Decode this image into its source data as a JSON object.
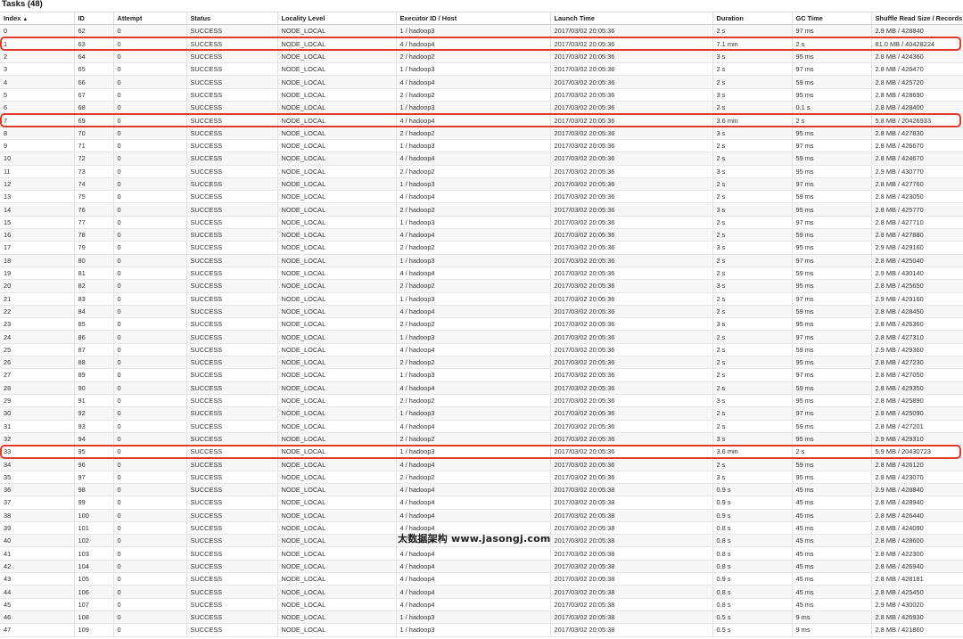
{
  "title": "Tasks (48)",
  "columns": [
    "Index",
    "ID",
    "Attempt",
    "Status",
    "Locality Level",
    "Executor ID / Host",
    "Launch Time",
    "Duration",
    "GC Time",
    "Shuffle Read Size / Records"
  ],
  "sort_indicator": "▲",
  "highlight_color": "#e5392b",
  "highlighted_rows": [
    1,
    7,
    33
  ],
  "rows": [
    [
      "0",
      "62",
      "0",
      "SUCCESS",
      "NODE_LOCAL",
      "1 / hadoop3",
      "2017/03/02 20:05:36",
      "2 s",
      "97 ms",
      "2.9 MB / 428840"
    ],
    [
      "1",
      "63",
      "0",
      "SUCCESS",
      "NODE_LOCAL",
      "4 / hadoop4",
      "2017/03/02 20:05:36",
      "7.1 min",
      "2 s",
      "81.0 MB / 40428224"
    ],
    [
      "2",
      "64",
      "0",
      "SUCCESS",
      "NODE_LOCAL",
      "2 / hadoop2",
      "2017/03/02 20:05:36",
      "3 s",
      "95 ms",
      "2.8 MB / 424360"
    ],
    [
      "3",
      "65",
      "0",
      "SUCCESS",
      "NODE_LOCAL",
      "1 / hadoop3",
      "2017/03/02 20:05:36",
      "2 s",
      "97 ms",
      "2.8 MB / 426470"
    ],
    [
      "4",
      "66",
      "0",
      "SUCCESS",
      "NODE_LOCAL",
      "4 / hadoop4",
      "2017/03/02 20:05:36",
      "2 s",
      "59 ms",
      "2.8 MB / 425720"
    ],
    [
      "5",
      "67",
      "0",
      "SUCCESS",
      "NODE_LOCAL",
      "2 / hadoop2",
      "2017/03/02 20:05:36",
      "3 s",
      "95 ms",
      "2.8 MB / 428690"
    ],
    [
      "6",
      "68",
      "0",
      "SUCCESS",
      "NODE_LOCAL",
      "1 / hadoop3",
      "2017/03/02 20:05:36",
      "2 s",
      "0.1 s",
      "2.8 MB / 428400"
    ],
    [
      "7",
      "69",
      "0",
      "SUCCESS",
      "NODE_LOCAL",
      "4 / hadoop4",
      "2017/03/02 20:05:36",
      "3.6 min",
      "2 s",
      "5.8 MB / 20426933"
    ],
    [
      "8",
      "70",
      "0",
      "SUCCESS",
      "NODE_LOCAL",
      "2 / hadoop2",
      "2017/03/02 20:05:36",
      "3 s",
      "95 ms",
      "2.8 MB / 427830"
    ],
    [
      "9",
      "71",
      "0",
      "SUCCESS",
      "NODE_LOCAL",
      "1 / hadoop3",
      "2017/03/02 20:05:36",
      "2 s",
      "97 ms",
      "2.8 MB / 426670"
    ],
    [
      "10",
      "72",
      "0",
      "SUCCESS",
      "NODE_LOCAL",
      "4 / hadoop4",
      "2017/03/02 20:05:36",
      "2 s",
      "59 ms",
      "2.8 MB / 424670"
    ],
    [
      "11",
      "73",
      "0",
      "SUCCESS",
      "NODE_LOCAL",
      "2 / hadoop2",
      "2017/03/02 20:05:36",
      "3 s",
      "95 ms",
      "2.9 MB / 430770"
    ],
    [
      "12",
      "74",
      "0",
      "SUCCESS",
      "NODE_LOCAL",
      "1 / hadoop3",
      "2017/03/02 20:05:36",
      "2 s",
      "97 ms",
      "2.8 MB / 427760"
    ],
    [
      "13",
      "75",
      "0",
      "SUCCESS",
      "NODE_LOCAL",
      "4 / hadoop4",
      "2017/03/02 20:05:36",
      "2 s",
      "59 ms",
      "2.8 MB / 423050"
    ],
    [
      "14",
      "76",
      "0",
      "SUCCESS",
      "NODE_LOCAL",
      "2 / hadoop2",
      "2017/03/02 20:05:36",
      "3 s",
      "95 ms",
      "2.8 MB / 425770"
    ],
    [
      "15",
      "77",
      "0",
      "SUCCESS",
      "NODE_LOCAL",
      "1 / hadoop3",
      "2017/03/02 20:05:36",
      "2 s",
      "97 ms",
      "2.8 MB / 427710"
    ],
    [
      "16",
      "78",
      "0",
      "SUCCESS",
      "NODE_LOCAL",
      "4 / hadoop4",
      "2017/03/02 20:05:36",
      "2 s",
      "59 ms",
      "2.8 MB / 427880"
    ],
    [
      "17",
      "79",
      "0",
      "SUCCESS",
      "NODE_LOCAL",
      "2 / hadoop2",
      "2017/03/02 20:05:36",
      "3 s",
      "95 ms",
      "2.9 MB / 429160"
    ],
    [
      "18",
      "80",
      "0",
      "SUCCESS",
      "NODE_LOCAL",
      "1 / hadoop3",
      "2017/03/02 20:05:36",
      "2 s",
      "97 ms",
      "2.8 MB / 425040"
    ],
    [
      "19",
      "81",
      "0",
      "SUCCESS",
      "NODE_LOCAL",
      "4 / hadoop4",
      "2017/03/02 20:05:36",
      "2 s",
      "59 ms",
      "2.9 MB / 430140"
    ],
    [
      "20",
      "82",
      "0",
      "SUCCESS",
      "NODE_LOCAL",
      "2 / hadoop2",
      "2017/03/02 20:05:36",
      "3 s",
      "95 ms",
      "2.8 MB / 425650"
    ],
    [
      "21",
      "83",
      "0",
      "SUCCESS",
      "NODE_LOCAL",
      "1 / hadoop3",
      "2017/03/02 20:05:36",
      "2 s",
      "97 ms",
      "2.9 MB / 429160"
    ],
    [
      "22",
      "84",
      "0",
      "SUCCESS",
      "NODE_LOCAL",
      "4 / hadoop4",
      "2017/03/02 20:05:36",
      "2 s",
      "59 ms",
      "2.8 MB / 428450"
    ],
    [
      "23",
      "85",
      "0",
      "SUCCESS",
      "NODE_LOCAL",
      "2 / hadoop2",
      "2017/03/02 20:05:36",
      "3 s",
      "95 ms",
      "2.8 MB / 426360"
    ],
    [
      "24",
      "86",
      "0",
      "SUCCESS",
      "NODE_LOCAL",
      "1 / hadoop3",
      "2017/03/02 20:05:36",
      "2 s",
      "97 ms",
      "2.8 MB / 427310"
    ],
    [
      "25",
      "87",
      "0",
      "SUCCESS",
      "NODE_LOCAL",
      "4 / hadoop4",
      "2017/03/02 20:05:36",
      "2 s",
      "59 ms",
      "2.9 MB / 429360"
    ],
    [
      "26",
      "88",
      "0",
      "SUCCESS",
      "NODE_LOCAL",
      "2 / hadoop2",
      "2017/03/02 20:05:36",
      "2 s",
      "95 ms",
      "2.8 MB / 427230"
    ],
    [
      "27",
      "89",
      "0",
      "SUCCESS",
      "NODE_LOCAL",
      "1 / hadoop3",
      "2017/03/02 20:05:36",
      "2 s",
      "97 ms",
      "2.8 MB / 427050"
    ],
    [
      "28",
      "90",
      "0",
      "SUCCESS",
      "NODE_LOCAL",
      "4 / hadoop4",
      "2017/03/02 20:05:36",
      "2 s",
      "59 ms",
      "2.8 MB / 429350"
    ],
    [
      "29",
      "91",
      "0",
      "SUCCESS",
      "NODE_LOCAL",
      "2 / hadoop2",
      "2017/03/02 20:05:36",
      "3 s",
      "95 ms",
      "2.8 MB / 425890"
    ],
    [
      "30",
      "92",
      "0",
      "SUCCESS",
      "NODE_LOCAL",
      "1 / hadoop3",
      "2017/03/02 20:05:36",
      "2 s",
      "97 ms",
      "2.8 MB / 425090"
    ],
    [
      "31",
      "93",
      "0",
      "SUCCESS",
      "NODE_LOCAL",
      "4 / hadoop4",
      "2017/03/02 20:05:36",
      "2 s",
      "59 ms",
      "2.8 MB / 427201"
    ],
    [
      "32",
      "94",
      "0",
      "SUCCESS",
      "NODE_LOCAL",
      "2 / hadoop2",
      "2017/03/02 20:05:36",
      "3 s",
      "95 ms",
      "2.9 MB / 429310"
    ],
    [
      "33",
      "95",
      "0",
      "SUCCESS",
      "NODE_LOCAL",
      "1 / hadoop3",
      "2017/03/02 20:05:36",
      "3.6 min",
      "2 s",
      "5.9 MB / 20430723"
    ],
    [
      "34",
      "96",
      "0",
      "SUCCESS",
      "NODE_LOCAL",
      "4 / hadoop4",
      "2017/03/02 20:05:36",
      "2 s",
      "59 ms",
      "2.8 MB / 426120"
    ],
    [
      "35",
      "97",
      "0",
      "SUCCESS",
      "NODE_LOCAL",
      "2 / hadoop2",
      "2017/03/02 20:05:36",
      "3 s",
      "95 ms",
      "2.8 MB / 423070"
    ],
    [
      "36",
      "98",
      "0",
      "SUCCESS",
      "NODE_LOCAL",
      "4 / hadoop4",
      "2017/03/02 20:05:38",
      "0.9 s",
      "45 ms",
      "2.9 MB / 428840"
    ],
    [
      "37",
      "99",
      "0",
      "SUCCESS",
      "NODE_LOCAL",
      "4 / hadoop4",
      "2017/03/02 20:05:38",
      "0.9 s",
      "45 ms",
      "2.8 MB / 428940"
    ],
    [
      "38",
      "100",
      "0",
      "SUCCESS",
      "NODE_LOCAL",
      "4 / hadoop4",
      "2017/03/02 20:05:38",
      "0.9 s",
      "45 ms",
      "2.8 MB / 426440"
    ],
    [
      "39",
      "101",
      "0",
      "SUCCESS",
      "NODE_LOCAL",
      "4 / hadoop4",
      "2017/03/02 20:05:38",
      "0.8 s",
      "45 ms",
      "2.8 MB / 424090"
    ],
    [
      "40",
      "102",
      "0",
      "SUCCESS",
      "NODE_LOCAL",
      "4 / hadoop4",
      "2017/03/02 20:05:38",
      "0.8 s",
      "45 ms",
      "2.8 MB / 428600"
    ],
    [
      "41",
      "103",
      "0",
      "SUCCESS",
      "NODE_LOCAL",
      "4 / hadoop4",
      "2017/03/02 20:05:38",
      "0.8 s",
      "45 ms",
      "2.8 MB / 422300"
    ],
    [
      "42",
      "104",
      "0",
      "SUCCESS",
      "NODE_LOCAL",
      "4 / hadoop4",
      "2017/03/02 20:05:38",
      "0.8 s",
      "45 ms",
      "2.8 MB / 426940"
    ],
    [
      "43",
      "105",
      "0",
      "SUCCESS",
      "NODE_LOCAL",
      "4 / hadoop4",
      "2017/03/02 20:05:38",
      "0.9 s",
      "45 ms",
      "2.8 MB / 428181"
    ],
    [
      "44",
      "106",
      "0",
      "SUCCESS",
      "NODE_LOCAL",
      "4 / hadoop4",
      "2017/03/02 20:05:38",
      "0.8 s",
      "45 ms",
      "2.8 MB / 425450"
    ],
    [
      "45",
      "107",
      "0",
      "SUCCESS",
      "NODE_LOCAL",
      "4 / hadoop4",
      "2017/03/02 20:05:38",
      "0.8 s",
      "45 ms",
      "2.9 MB / 430020"
    ],
    [
      "46",
      "108",
      "0",
      "SUCCESS",
      "NODE_LOCAL",
      "1 / hadoop3",
      "2017/03/02 20:05:38",
      "0.5 s",
      "9 ms",
      "2.8 MB / 426930"
    ],
    [
      "47",
      "109",
      "0",
      "SUCCESS",
      "NODE_LOCAL",
      "1 / hadoop3",
      "2017/03/02 20:05:38",
      "0.5 s",
      "9 ms",
      "2.8 MB / 421860"
    ]
  ],
  "watermark": "大数据架构  www.jasongj.com"
}
